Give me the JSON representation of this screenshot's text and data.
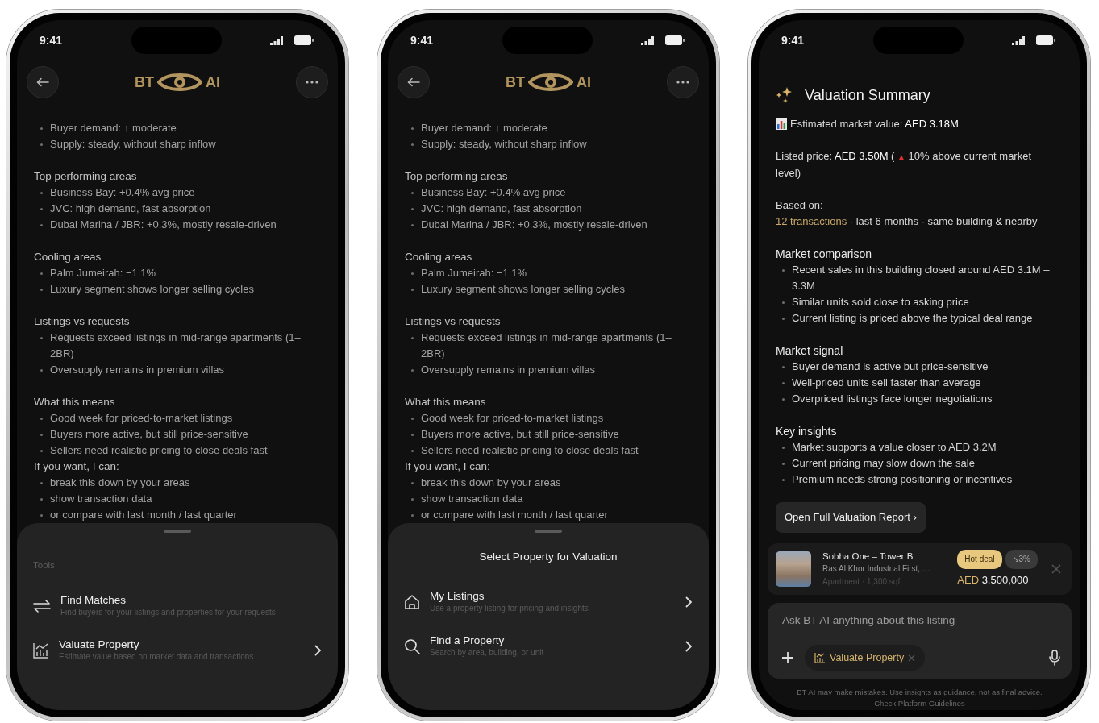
{
  "phones": [
    {
      "kind": "chat",
      "status_bar": {
        "time": "9:41"
      },
      "header": {
        "logo_left": "BT",
        "logo_right": "AI"
      },
      "sections": [
        {
          "joined": false,
          "items": [
            "Buyer demand: ↑ moderate",
            "Supply: steady, without sharp inflow"
          ]
        },
        {
          "joined": false,
          "heading": "Top performing areas",
          "items": [
            "Business Bay: +0.4% avg price",
            "JVC: high demand, fast absorption",
            "Dubai Marina / JBR: +0.3%, mostly resale-driven"
          ]
        },
        {
          "joined": false,
          "heading": "Cooling areas",
          "items": [
            "Palm Jumeirah: −1.1%",
            "Luxury segment shows longer selling cycles"
          ]
        },
        {
          "joined": false,
          "heading": "Listings vs requests",
          "items": [
            "Requests exceed listings in mid-range apartments (1–2BR)",
            "Oversupply remains in premium villas"
          ]
        },
        {
          "joined": false,
          "heading": "What this means",
          "items": [
            "Good week for priced-to-market listings",
            "Buyers more active, but still price-sensitive",
            "Sellers need realistic pricing to close deals fast"
          ]
        },
        {
          "joined": true,
          "heading": "If you want, I can:",
          "items": [
            "break this down by your areas",
            "show transaction data",
            "or compare with last month / last quarter"
          ]
        }
      ],
      "sheet": {
        "kind": "tools",
        "label": "Tools",
        "items": [
          {
            "kind": "arrows",
            "title": "Find Matches",
            "subtitle": "Find buyers for your listings and properties for your requests",
            "chevron": false
          },
          {
            "kind": "chart",
            "title": "Valuate Property",
            "subtitle": "Estimate value based on market data and transactions",
            "chevron": true
          }
        ]
      }
    },
    {
      "kind": "chat",
      "status_bar": {
        "time": "9:41"
      },
      "header": {
        "logo_left": "BT",
        "logo_right": "AI"
      },
      "sections": [
        {
          "joined": false,
          "items": [
            "Buyer demand: ↑ moderate",
            "Supply: steady, without sharp inflow"
          ]
        },
        {
          "joined": false,
          "heading": "Top performing areas",
          "items": [
            "Business Bay: +0.4% avg price",
            "JVC: high demand, fast absorption",
            "Dubai Marina / JBR: +0.3%, mostly resale-driven"
          ]
        },
        {
          "joined": false,
          "heading": "Cooling areas",
          "items": [
            "Palm Jumeirah: −1.1%",
            "Luxury segment shows longer selling cycles"
          ]
        },
        {
          "joined": false,
          "heading": "Listings vs requests",
          "items": [
            "Requests exceed listings in mid-range apartments (1–2BR)",
            "Oversupply remains in premium villas"
          ]
        },
        {
          "joined": false,
          "heading": "What this means",
          "items": [
            "Good week for priced-to-market listings",
            "Buyers more active, but still price-sensitive",
            "Sellers need realistic pricing to close deals fast"
          ]
        },
        {
          "joined": true,
          "heading": "If you want, I can:",
          "items": [
            "break this down by your areas",
            "show transaction data",
            "or compare with last month / last quarter"
          ]
        }
      ],
      "sheet": {
        "kind": "picker",
        "title": "Select Property for Valuation",
        "items": [
          {
            "kind": "house",
            "title": "My Listings",
            "subtitle": "Use a property listing for pricing and insights",
            "chevron": true
          },
          {
            "kind": "search",
            "title": "Find a Property",
            "subtitle": "Search by area, building, or unit",
            "chevron": true
          }
        ]
      }
    },
    {
      "kind": "summary",
      "status_bar": {
        "time": "9:41"
      },
      "title": "Valuation Summary",
      "estimate": "Estimated market value: **AED 3.18M**",
      "listed_price": {
        "before": "Listed price: **AED 3.50M** (",
        "marker": "▲",
        "after": "10% above current market level)"
      },
      "based_on": {
        "label": "Based on:",
        "link": "12 transactions",
        "rest": " · last 6 months · same building & nearby"
      },
      "sections": [
        {
          "joined": false,
          "heading": "Market comparison",
          "items": [
            "Recent sales in this building closed around AED 3.1M – 3.3M",
            "Similar units sold close to asking price",
            "Current listing is priced above the typical deal range"
          ]
        },
        {
          "joined": false,
          "heading": "Market signal",
          "items": [
            "Buyer demand is active but price-sensitive",
            "Well-priced units sell faster than average",
            "Overpriced listings face longer negotiations"
          ]
        },
        {
          "joined": false,
          "heading": "Key insights",
          "items": [
            "Market supports a value closer to AED 3.2M",
            "Current pricing may slow down the sale",
            "Premium needs strong positioning or incentives"
          ]
        }
      ],
      "report_button": "Open Full Valuation Report ›",
      "listing": {
        "name": "Sobha One – Tower B",
        "location": "Ras Al Khor Industrial First, …",
        "details": "Apartment · 1,300 sqft",
        "badges": [
          {
            "text": "Hot deal",
            "color": "#e8c77e"
          },
          {
            "text": "↘3%",
            "color": "#3a3a3a"
          }
        ],
        "currency": "AED",
        "price": "3,500,000"
      },
      "composer": {
        "placeholder": "Ask BT AI anything about this listing",
        "chip": "Valuate Property"
      },
      "disclaimer": {
        "text": "BT AI may make mistakes. Use insights as guidance, not as final advice.",
        "prefix": "Check",
        "link": "Platform Guidelines"
      }
    }
  ]
}
